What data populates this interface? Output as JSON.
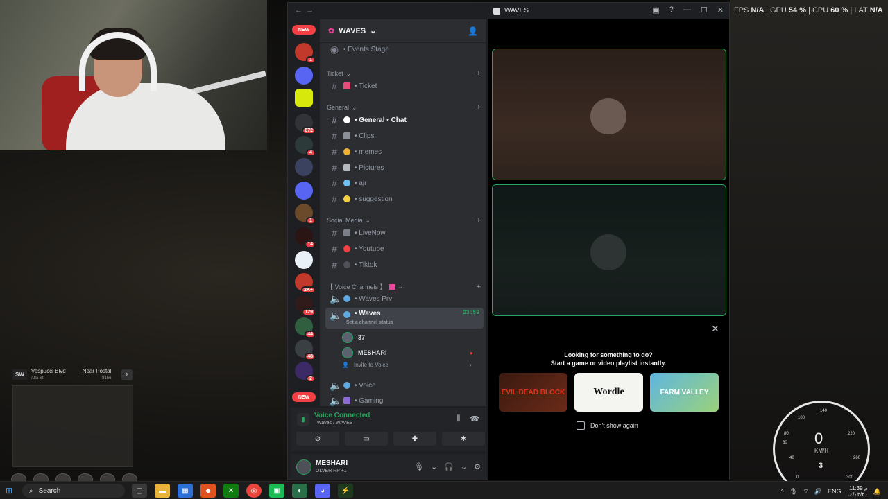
{
  "overlay": {
    "fps_label": "FPS",
    "fps": "N/A",
    "gpu_label": "GPU",
    "gpu": "54 %",
    "cpu_label": "CPU",
    "cpu": "60 %",
    "lat_label": "LAT",
    "lat": "N/A",
    "sep": "|"
  },
  "game": {
    "hud_badge": "SW",
    "street": "Vespucci Blvd",
    "street_sub": "Alta St",
    "postal_label": "Near Postal",
    "postal": "8156",
    "speed": "0",
    "speed_unit": "KM/H",
    "gear": "3",
    "ticks": [
      "40",
      "60",
      "80",
      "100",
      "140",
      "180",
      "220",
      "260",
      "300",
      "0"
    ]
  },
  "discord": {
    "window_title": "WAVES",
    "nav_back": "←",
    "nav_forward": "→",
    "rail": {
      "new_top": "NEW",
      "new_bottom": "NEW",
      "badges": [
        "77",
        "1",
        "872",
        "4",
        "1",
        "14",
        "2K+",
        "129",
        "44",
        "48",
        "2"
      ]
    },
    "server_name": "WAVES",
    "channels": {
      "events_stage": "• Events Stage",
      "cat_ticket": "Ticket",
      "ticket": "• Ticket",
      "cat_general": "General",
      "general_chat": "• General • Chat",
      "clips": "• Clips",
      "memes": "• memes",
      "pictures": "• Pictures",
      "ajr": "• ajr",
      "suggestion": "• suggestion",
      "cat_social": "Social Media",
      "livenow": "• LiveNow",
      "youtube": "• Youtube",
      "tiktok": "• Tiktok",
      "cat_voice": "【 Voice Channels 】",
      "waves_prv": "• Waves Prv",
      "waves": "• Waves",
      "waves_timer": "23:59",
      "waves_status": "Set a channel status",
      "member_1": "37",
      "member_2": "MESHARI",
      "invite": "Invite to Voice",
      "voice": "• Voice",
      "gaming": "• Gaming"
    },
    "voice_panel": {
      "title": "Voice Connected",
      "sub": "Waves / WAVES"
    },
    "user": {
      "name": "MESHARI",
      "status": "OLVER RP +1"
    },
    "activity": {
      "line1": "Looking for something to do?",
      "line2": "Start a game or video playlist instantly.",
      "cards": [
        "EVIL DEAD BLOCK",
        "Wordle",
        "FARM VALLEY"
      ],
      "dont_show": "Don't show again"
    }
  },
  "taskbar": {
    "search_placeholder": "Search",
    "lang": "ENG",
    "time": "11:39 م",
    "date": "١٤/٠٣/٢٠"
  }
}
